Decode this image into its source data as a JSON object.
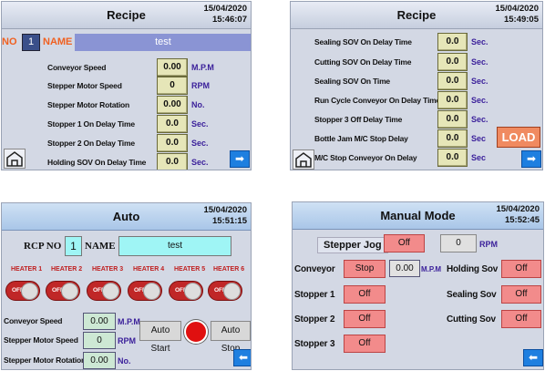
{
  "p1": {
    "title": "Recipe",
    "date": "15/04/2020",
    "time": "15:46:07",
    "no_label": "NO",
    "no_value": "1",
    "name_label": "NAME",
    "name_value": "test",
    "rows": [
      {
        "label": "Conveyor Speed",
        "value": "0.00",
        "unit": "M.P.M"
      },
      {
        "label": "Stepper Motor Speed",
        "value": "0",
        "unit": "RPM"
      },
      {
        "label": "Stepper Motor Rotation",
        "value": "0.00",
        "unit": "No."
      },
      {
        "label": "Stopper 1 On Delay Time",
        "value": "0.0",
        "unit": "Sec."
      },
      {
        "label": "Stopper 2 On Delay Time",
        "value": "0.0",
        "unit": "Sec."
      },
      {
        "label": "Holding SOV On Delay Time",
        "value": "0.0",
        "unit": "Sec."
      }
    ],
    "next": "➡"
  },
  "p2": {
    "title": "Recipe",
    "date": "15/04/2020",
    "time": "15:49:05",
    "rows": [
      {
        "label": "Sealing SOV On Delay Time",
        "value": "0.0",
        "unit": "Sec."
      },
      {
        "label": "Cutting SOV On Delay Time",
        "value": "0.0",
        "unit": "Sec."
      },
      {
        "label": "Sealing SOV On Time",
        "value": "0.0",
        "unit": "Sec."
      },
      {
        "label": "Run Cycle Conveyor On Delay Time",
        "value": "0.0",
        "unit": "Sec."
      },
      {
        "label": "Stopper 3 Off Delay Time",
        "value": "0.0",
        "unit": "Sec."
      },
      {
        "label": "Bottle Jam M/C Stop Delay",
        "value": "0.0",
        "unit": "Sec"
      },
      {
        "label": "M/C Stop Conveyor On Delay",
        "value": "0.0",
        "unit": "Sec"
      }
    ],
    "load": "LOAD",
    "next": "➡"
  },
  "p3": {
    "title": "Auto",
    "date": "15/04/2020",
    "time": "15:51:15",
    "rcp_label": "RCP NO",
    "rcp_value": "1",
    "name_label": "NAME",
    "name_value": "test",
    "heaters": [
      {
        "label": "HEATER 1",
        "state": "OFF"
      },
      {
        "label": "HEATER 2",
        "state": "OFF"
      },
      {
        "label": "HEATER 3",
        "state": "OFF"
      },
      {
        "label": "HEATER 4",
        "state": "OFF"
      },
      {
        "label": "HEATER 5",
        "state": "OFF"
      },
      {
        "label": "HEATER 6",
        "state": "OFF"
      }
    ],
    "rows": [
      {
        "label": "Conveyor Speed",
        "value": "0.00",
        "unit": "M.P.M"
      },
      {
        "label": "Stepper Motor Speed",
        "value": "0",
        "unit": "RPM"
      },
      {
        "label": "Stepper Motor Rotation",
        "value": "0.00",
        "unit": "No."
      }
    ],
    "auto_start": "Auto Start",
    "auto_stop": "Auto Stop",
    "back": "⬅"
  },
  "p4": {
    "title": "Manual Mode",
    "date": "15/04/2020",
    "time": "15:52:45",
    "jog_label": "Stepper Jog",
    "jog_state": "Off",
    "jog_value": "0",
    "jog_unit": "RPM",
    "conveyor_label": "Conveyor",
    "conveyor_btn": "Stop",
    "conveyor_value": "0.00",
    "conveyor_unit": "M.P.M",
    "holding_label": "Holding Sov",
    "holding_state": "Off",
    "stopper1_label": "Stopper 1",
    "stopper1_state": "Off",
    "sealing_label": "Sealing Sov",
    "sealing_state": "Off",
    "stopper2_label": "Stopper 2",
    "stopper2_state": "Off",
    "cutting_label": "Cutting Sov",
    "cutting_state": "Off",
    "stopper3_label": "Stopper 3",
    "stopper3_state": "Off",
    "back": "⬅"
  }
}
